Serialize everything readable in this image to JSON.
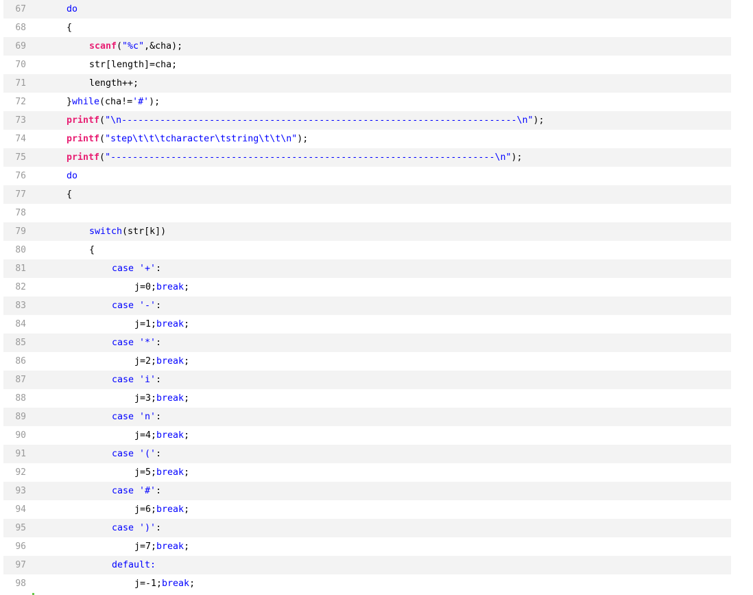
{
  "code": {
    "lines": [
      {
        "number": "67",
        "tokens": [
          {
            "t": "do",
            "k": "kw"
          }
        ],
        "indent": 0
      },
      {
        "number": "68",
        "tokens": [
          {
            "t": "{",
            "k": "plain"
          }
        ],
        "indent": 0
      },
      {
        "number": "69",
        "tokens": [
          {
            "t": "scanf",
            "k": "fn"
          },
          {
            "t": "(",
            "k": "plain"
          },
          {
            "t": "\"%c\"",
            "k": "str"
          },
          {
            "t": ",&cha);",
            "k": "plain"
          }
        ],
        "indent": 1
      },
      {
        "number": "70",
        "tokens": [
          {
            "t": "str[length]=cha;",
            "k": "plain"
          }
        ],
        "indent": 1
      },
      {
        "number": "71",
        "tokens": [
          {
            "t": "length++;",
            "k": "plain"
          }
        ],
        "indent": 1
      },
      {
        "number": "72",
        "tokens": [
          {
            "t": "}",
            "k": "plain"
          },
          {
            "t": "while",
            "k": "kw"
          },
          {
            "t": "(cha!=",
            "k": "plain"
          },
          {
            "t": "'#'",
            "k": "str"
          },
          {
            "t": ");",
            "k": "plain"
          }
        ],
        "indent": 0
      },
      {
        "number": "73",
        "tokens": [
          {
            "t": "printf",
            "k": "fn"
          },
          {
            "t": "(",
            "k": "plain"
          },
          {
            "t": "\"\\n------------------------------------------------------------------------\\n\"",
            "k": "str"
          },
          {
            "t": ");",
            "k": "plain"
          }
        ],
        "indent": 0
      },
      {
        "number": "74",
        "tokens": [
          {
            "t": "printf",
            "k": "fn"
          },
          {
            "t": "(",
            "k": "plain"
          },
          {
            "t": "\"step\\t\\t\\tcharacter\\tstring\\t\\t\\n\"",
            "k": "str"
          },
          {
            "t": ");",
            "k": "plain"
          }
        ],
        "indent": 0
      },
      {
        "number": "75",
        "tokens": [
          {
            "t": "printf",
            "k": "fn"
          },
          {
            "t": "(",
            "k": "plain"
          },
          {
            "t": "\"----------------------------------------------------------------------\\n\"",
            "k": "str"
          },
          {
            "t": ");",
            "k": "plain"
          }
        ],
        "indent": 0
      },
      {
        "number": "76",
        "tokens": [
          {
            "t": "do",
            "k": "kw"
          }
        ],
        "indent": 0
      },
      {
        "number": "77",
        "tokens": [
          {
            "t": "{",
            "k": "plain"
          }
        ],
        "indent": 0
      },
      {
        "number": "78",
        "tokens": [],
        "indent": 0
      },
      {
        "number": "79",
        "tokens": [
          {
            "t": "switch",
            "k": "kw"
          },
          {
            "t": "(str[k])",
            "k": "plain"
          }
        ],
        "indent": 1
      },
      {
        "number": "80",
        "tokens": [
          {
            "t": "{",
            "k": "plain"
          }
        ],
        "indent": 1
      },
      {
        "number": "81",
        "tokens": [
          {
            "t": "case",
            "k": "kw"
          },
          {
            "t": " ",
            "k": "plain"
          },
          {
            "t": "'+'",
            "k": "str"
          },
          {
            "t": ":",
            "k": "plain"
          }
        ],
        "indent": 2
      },
      {
        "number": "82",
        "tokens": [
          {
            "t": "j=0;",
            "k": "plain"
          },
          {
            "t": "break",
            "k": "kw"
          },
          {
            "t": ";",
            "k": "plain"
          }
        ],
        "indent": 3
      },
      {
        "number": "83",
        "tokens": [
          {
            "t": "case",
            "k": "kw"
          },
          {
            "t": " ",
            "k": "plain"
          },
          {
            "t": "'-'",
            "k": "str"
          },
          {
            "t": ":",
            "k": "plain"
          }
        ],
        "indent": 2
      },
      {
        "number": "84",
        "tokens": [
          {
            "t": "j=1;",
            "k": "plain"
          },
          {
            "t": "break",
            "k": "kw"
          },
          {
            "t": ";",
            "k": "plain"
          }
        ],
        "indent": 3
      },
      {
        "number": "85",
        "tokens": [
          {
            "t": "case",
            "k": "kw"
          },
          {
            "t": " ",
            "k": "plain"
          },
          {
            "t": "'*'",
            "k": "str"
          },
          {
            "t": ":",
            "k": "plain"
          }
        ],
        "indent": 2
      },
      {
        "number": "86",
        "tokens": [
          {
            "t": "j=2;",
            "k": "plain"
          },
          {
            "t": "break",
            "k": "kw"
          },
          {
            "t": ";",
            "k": "plain"
          }
        ],
        "indent": 3
      },
      {
        "number": "87",
        "tokens": [
          {
            "t": "case",
            "k": "kw"
          },
          {
            "t": " ",
            "k": "plain"
          },
          {
            "t": "'i'",
            "k": "str"
          },
          {
            "t": ":",
            "k": "plain"
          }
        ],
        "indent": 2
      },
      {
        "number": "88",
        "tokens": [
          {
            "t": "j=3;",
            "k": "plain"
          },
          {
            "t": "break",
            "k": "kw"
          },
          {
            "t": ";",
            "k": "plain"
          }
        ],
        "indent": 3
      },
      {
        "number": "89",
        "tokens": [
          {
            "t": "case",
            "k": "kw"
          },
          {
            "t": " ",
            "k": "plain"
          },
          {
            "t": "'n'",
            "k": "str"
          },
          {
            "t": ":",
            "k": "plain"
          }
        ],
        "indent": 2
      },
      {
        "number": "90",
        "tokens": [
          {
            "t": "j=4;",
            "k": "plain"
          },
          {
            "t": "break",
            "k": "kw"
          },
          {
            "t": ";",
            "k": "plain"
          }
        ],
        "indent": 3
      },
      {
        "number": "91",
        "tokens": [
          {
            "t": "case",
            "k": "kw"
          },
          {
            "t": " ",
            "k": "plain"
          },
          {
            "t": "'('",
            "k": "str"
          },
          {
            "t": ":",
            "k": "plain"
          }
        ],
        "indent": 2
      },
      {
        "number": "92",
        "tokens": [
          {
            "t": "j=5;",
            "k": "plain"
          },
          {
            "t": "break",
            "k": "kw"
          },
          {
            "t": ";",
            "k": "plain"
          }
        ],
        "indent": 3
      },
      {
        "number": "93",
        "tokens": [
          {
            "t": "case",
            "k": "kw"
          },
          {
            "t": " ",
            "k": "plain"
          },
          {
            "t": "'#'",
            "k": "str"
          },
          {
            "t": ":",
            "k": "plain"
          }
        ],
        "indent": 2
      },
      {
        "number": "94",
        "tokens": [
          {
            "t": "j=6;",
            "k": "plain"
          },
          {
            "t": "break",
            "k": "kw"
          },
          {
            "t": ";",
            "k": "plain"
          }
        ],
        "indent": 3
      },
      {
        "number": "95",
        "tokens": [
          {
            "t": "case",
            "k": "kw"
          },
          {
            "t": " ",
            "k": "plain"
          },
          {
            "t": "')'",
            "k": "str"
          },
          {
            "t": ":",
            "k": "plain"
          }
        ],
        "indent": 2
      },
      {
        "number": "96",
        "tokens": [
          {
            "t": "j=7;",
            "k": "plain"
          },
          {
            "t": "break",
            "k": "kw"
          },
          {
            "t": ";",
            "k": "plain"
          }
        ],
        "indent": 3
      },
      {
        "number": "97",
        "tokens": [
          {
            "t": "default:",
            "k": "kw"
          }
        ],
        "indent": 2
      },
      {
        "number": "98",
        "tokens": [
          {
            "t": "j=-1;",
            "k": "plain"
          },
          {
            "t": "break",
            "k": "kw"
          },
          {
            "t": ";",
            "k": "plain"
          }
        ],
        "indent": 3
      }
    ]
  },
  "colors": {
    "keyword": "#0000ff",
    "function": "#e81d72",
    "gutter_bar": "#68c74a",
    "stripe": "#f3f3f3",
    "line_number": "#999999"
  }
}
